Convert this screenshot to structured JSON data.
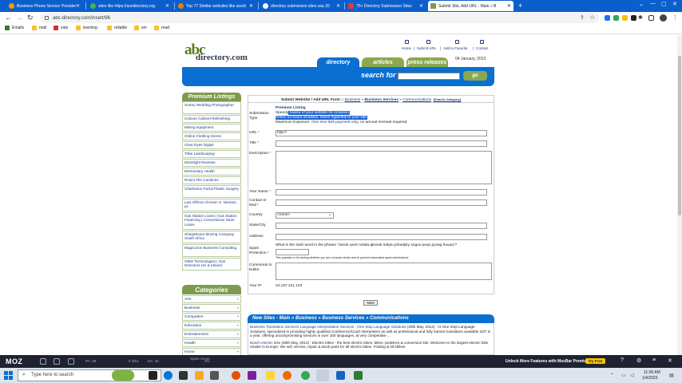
{
  "browser": {
    "tabs": [
      {
        "title": "Business Phone Service Provider"
      },
      {
        "title": "sites like https://acedirectory.org"
      },
      {
        "title": "Top 77 Similar websites like acedi"
      },
      {
        "title": "directory submission sites usa 20"
      },
      {
        "title": "75+ Directory Submission Sites"
      },
      {
        "title": "Submit Site, Add URL - Main » B"
      }
    ],
    "new_tab": "+",
    "url": "abc-directory.com/insert/96",
    "bookmarks": [
      "Emails",
      "mail",
      "voip",
      "learning",
      "reliable",
      "sm",
      "read"
    ]
  },
  "site": {
    "logo_top": "abc",
    "logo_bottom": "directory.com",
    "toplinks": [
      "Home",
      "Submit URL",
      "Add to Favorite",
      "Contact"
    ],
    "toplinks_sep": "|",
    "nav_tabs": [
      "directory",
      "articles",
      "press releases"
    ],
    "date": "04 January, 2023",
    "search_label": "search for",
    "go_label": "go"
  },
  "sidebar": {
    "premium_title": "Premium Listings",
    "premium_items": [
      "Surrey Wedding Photographer",
      "Colours Cabinet Refinishing",
      "Mining equipment",
      "Online Clothing Stores",
      "Clear Eyes Digital",
      "Tribe Landscaping",
      "Moonlight Reviews",
      "Elementary Health",
      "Rosini The Carolines",
      "Charleston Facial Plastic Surgery",
      "Law Offices of Kevin S. Neiman, pc",
      "Gas Station Loans | Gas Station Financing | Convenience Store Loans",
      "SharpMoore Moving Company South Africa",
      "MagnUzon Business Consulting",
      "GBW Technologies | Gas Detectors UK & Ireland"
    ],
    "categories_title": "Categories",
    "categories": [
      "Arts",
      "Business",
      "Computers",
      "Education",
      "Entertainment",
      "Health",
      "Home"
    ],
    "arrow": "»"
  },
  "form": {
    "head_prefix": "Submit WebSite / Add URL Form ::",
    "crumb_1": "Business",
    "crumb_sep": "»",
    "crumb_2": "Business Services",
    "crumb_3": "Communications",
    "search_category": "[Search Category]",
    "submission_type_label": "Submission Type",
    "premium_listing": "Premium Listing",
    "line1_plain": "Speedy",
    "line1_hl": " review of your website for inclusion.",
    "line2_hl": "Within 24 hours inclusion. Direct hyperlink to your site.",
    "line3_a": "Maximum Exposure.",
    "line3_b": "One time $49 payment only",
    "line3_c": ", no annual renewal required.",
    "url_label": "URL",
    "url_value": "http://",
    "title_label": "Title",
    "desc_label": "Description",
    "name_label": "Your Name",
    "email_label": "Contact E-Mail",
    "country_label": "Country",
    "country_value": "<none>",
    "state_label": "State/City",
    "address_label": "Address",
    "spam_label": "Spam Protection",
    "spam_question": "What is the sixth word in the phrase \"duruk vyret notala gkvexk sdepu jehadyky sogux peqo pyvaq huvaq\"?",
    "spam_note": "This question is for testing whether you are a human visitor and to prevent automated spam submissions",
    "comments_label": "Comments to Editor",
    "ip_label": "Your IP",
    "ip_value": "24.187.221.123",
    "required_mark": "*",
    "next_label": "Next"
  },
  "new_sites": {
    "title": "New Sites - Main » Business » Business Services » Communications",
    "item1_link": "Business Translation Services Language Interpretation Services - One Stop Language Solutions",
    "item1_date": "(29th May, 2014)",
    "item1_text": " : At One Stop Language Solutions, specialized in providing highly qualified Conference/Court Interpreters as well as professional and fully trained translators available 24/7 in a year, offering uncompromising services in over 150 languages, at very competitive ...",
    "item2_link": "Bosch electric bike",
    "item2_date": "(29th May, 2014)",
    "item2_text": " : Electric bikes - the best electric bikes, bikes, pedelecs & conversion kits. Welcome to the largest electric bike retailer in Europe. We sell, service, repair & stock parts for all electric bikes. Folding & tilt ebikes"
  },
  "mozbar": {
    "logo": "MOZ",
    "pa": "PA: 38",
    "links": "0 links",
    "da": "DA: 46",
    "spam_label": "Spam Score",
    "spam_value": "2%",
    "unlock": "Unlock More Features with MozBar Premium",
    "try": "Try Free"
  },
  "taskbar": {
    "search_placeholder": "Type here to search",
    "time": "11:06 AM",
    "date": "1/4/2023"
  },
  "colors": {
    "tabbar": "#0b5fcc",
    "accent_blue": "#0a6fd0",
    "accent_green": "#7d9b4e",
    "link": "#1a3a8a"
  }
}
